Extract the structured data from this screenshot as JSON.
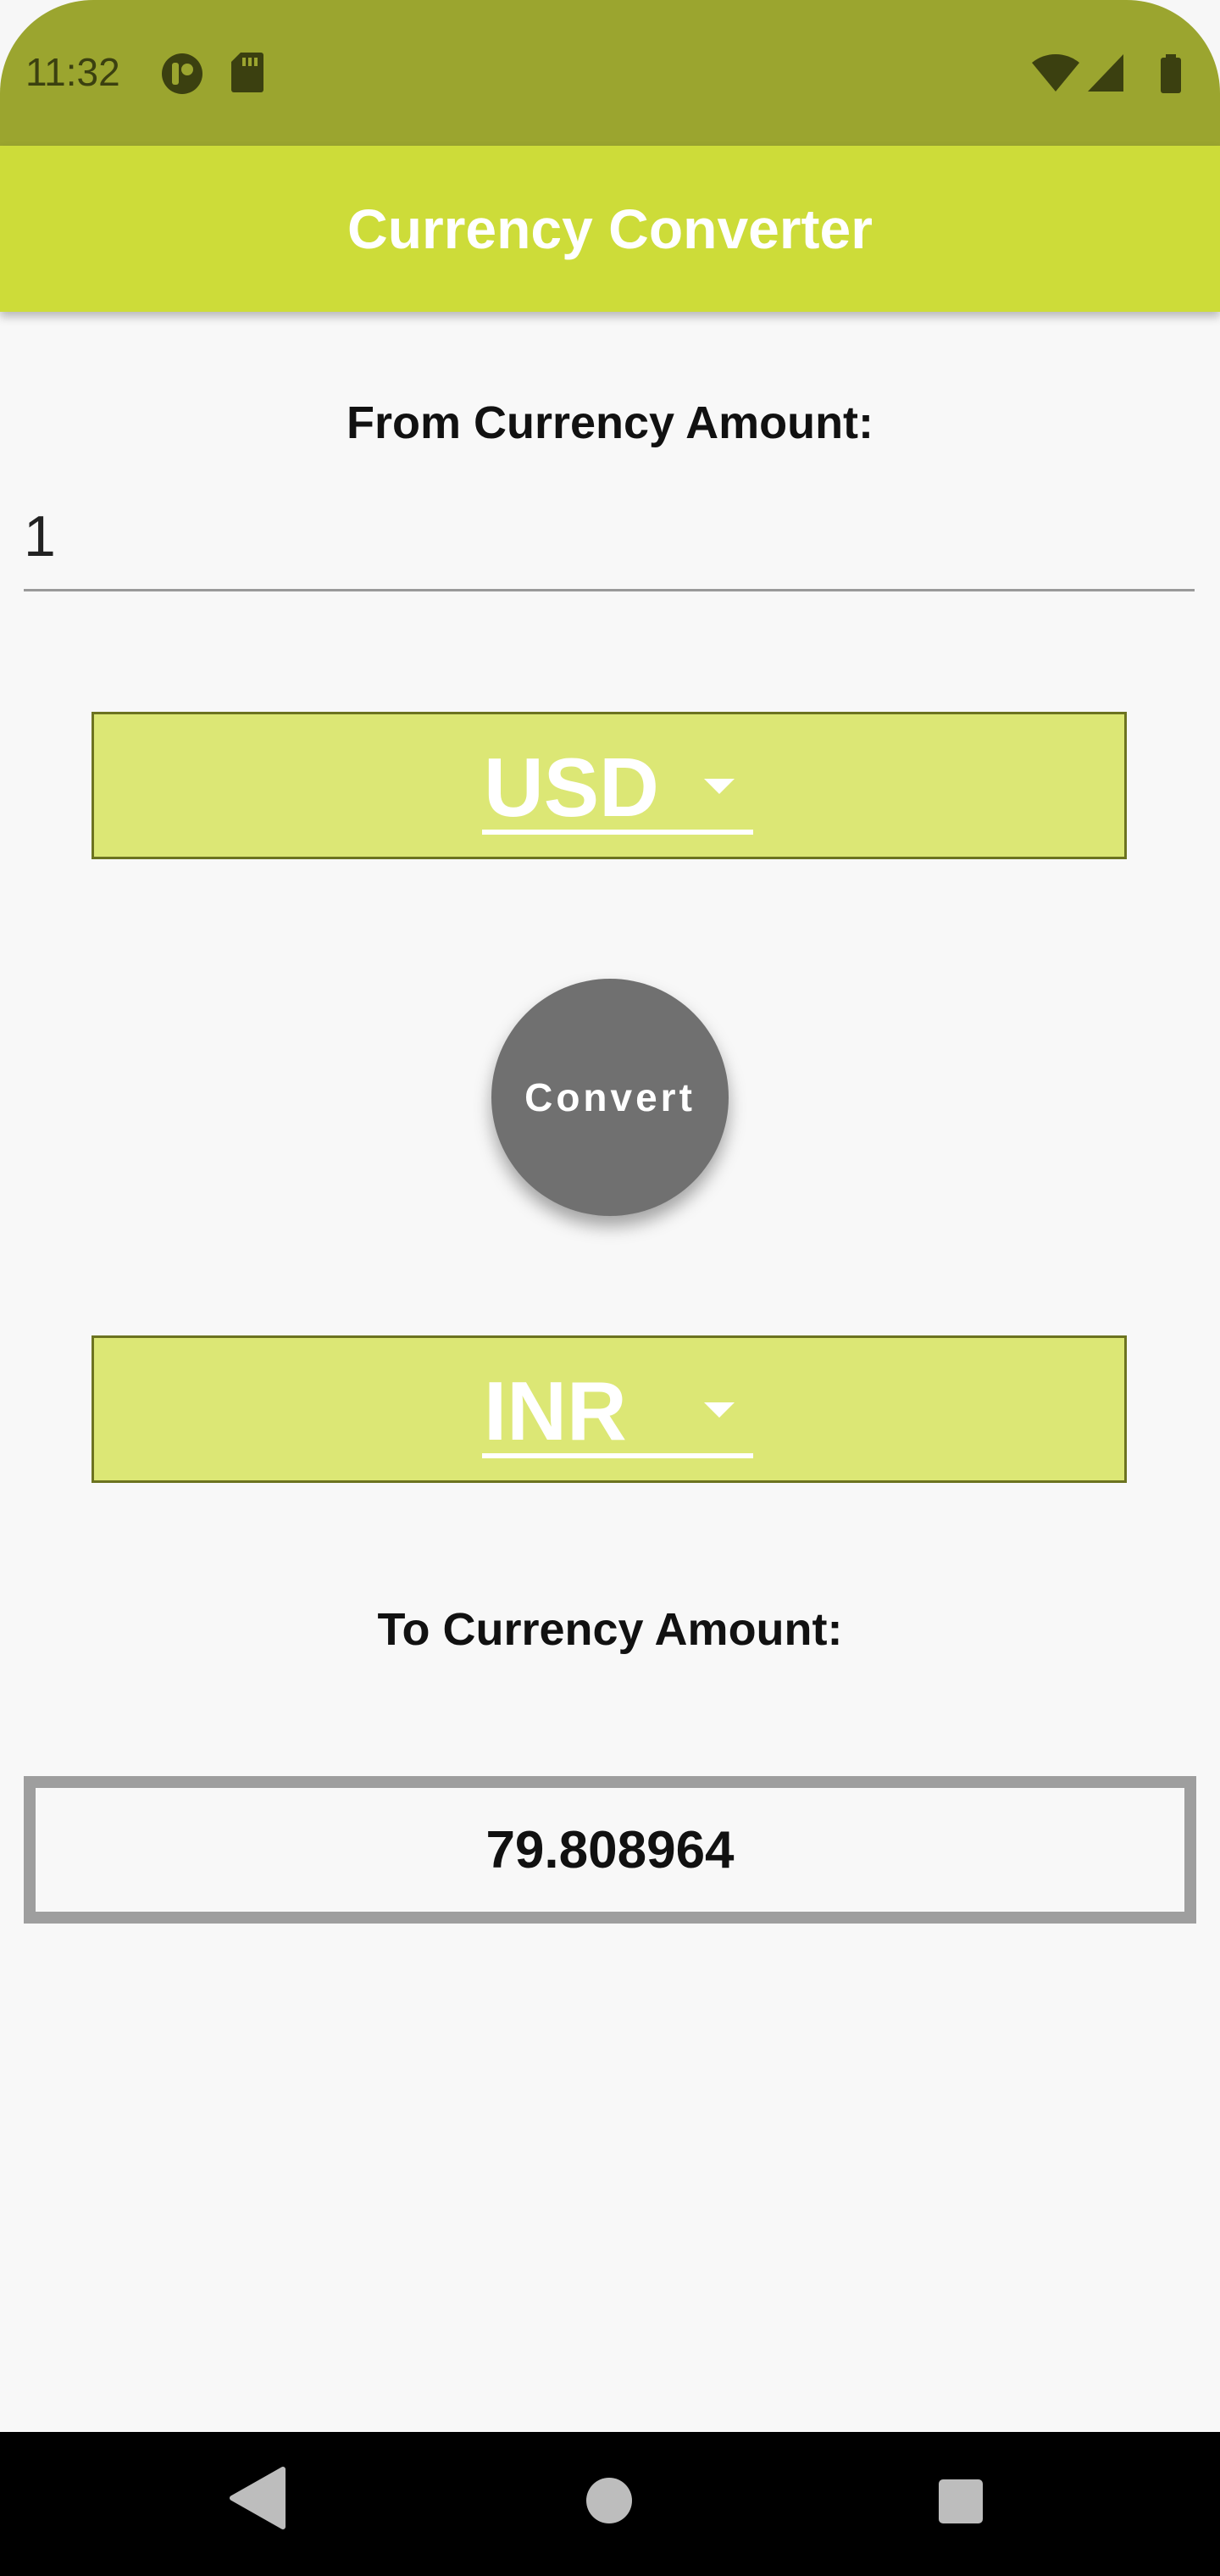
{
  "status_bar": {
    "time": "11:32",
    "icons": [
      "app-notification-icon",
      "sd-card-icon",
      "wifi-icon",
      "signal-icon",
      "battery-icon"
    ],
    "color": "#9ba52f"
  },
  "app_bar": {
    "title": "Currency Converter",
    "color": "#cddc39"
  },
  "form": {
    "from_label": "From Currency Amount:",
    "amount_value": "1",
    "from_currency": "USD",
    "convert_label": "Convert",
    "to_currency": "INR",
    "to_label": "To Currency Amount:",
    "result": "79.808964"
  },
  "nav_bar": {
    "icons": [
      "back-icon",
      "home-icon",
      "recent-apps-icon"
    ]
  },
  "colors": {
    "spinner_bg": "#dce775",
    "button_bg": "#707070",
    "result_border": "#9e9e9e"
  }
}
